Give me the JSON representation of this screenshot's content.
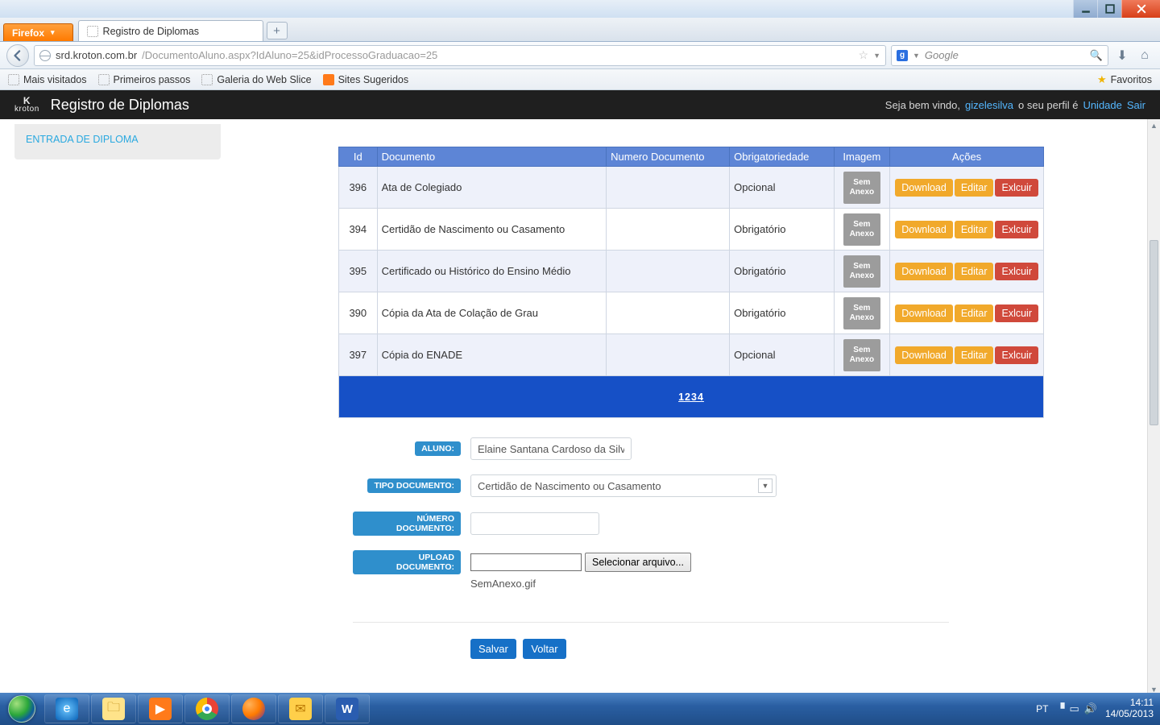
{
  "window": {
    "faded_title": ""
  },
  "browser": {
    "firefox_button": "Firefox",
    "tab_title": "Registro de Diplomas",
    "url_host": "srd.kroton.com.br",
    "url_path": "/DocumentoAluno.aspx?IdAluno=25&idProcessoGraduacao=25",
    "search_placeholder": "Google"
  },
  "bookmarks": {
    "b1": "Mais visitados",
    "b2": "Primeiros passos",
    "b3": "Galeria do Web Slice",
    "b4": "Sites Sugeridos",
    "fav": "Favoritos"
  },
  "appbar": {
    "brand": "kroton",
    "title": "Registro de Diplomas",
    "welcome_pre": "Seja bem vindo,",
    "user": "gizelesilva",
    "profile_txt": "o seu perfil é",
    "unit": "Unidade",
    "exit": "Sair"
  },
  "sidebar": {
    "entry": "ENTRADA DE DIPLOMA"
  },
  "table": {
    "headers": {
      "id": "Id",
      "doc": "Documento",
      "num": "Numero Documento",
      "ob": "Obrigatoriedade",
      "img": "Imagem",
      "ac": "Ações"
    },
    "noimg_l1": "Sem",
    "noimg_l2": "Anexo",
    "btn_dl": "Download",
    "btn_ed": "Editar",
    "btn_ex": "Exlcuir",
    "pager": "1234",
    "rows": [
      {
        "id": "396",
        "doc": "Ata de Colegiado",
        "num": "",
        "ob": "Opcional"
      },
      {
        "id": "394",
        "doc": "Certidão de Nascimento ou Casamento",
        "num": "",
        "ob": "Obrigatório"
      },
      {
        "id": "395",
        "doc": "Certificado ou Histórico do Ensino Médio",
        "num": "",
        "ob": "Obrigatório"
      },
      {
        "id": "390",
        "doc": "Cópia da Ata de Colação de Grau",
        "num": "",
        "ob": "Obrigatório"
      },
      {
        "id": "397",
        "doc": "Cópia do ENADE",
        "num": "",
        "ob": "Opcional"
      }
    ]
  },
  "form": {
    "l_aluno": "ALUNO:",
    "v_aluno": "Elaine Santana Cardoso da Silva",
    "l_tipo": "TIPO DOCUMENTO:",
    "v_tipo": "Certidão de Nascimento ou Casamento",
    "l_num": "NÚMERO DOCUMENTO:",
    "l_upload": "UPLOAD DOCUMENTO:",
    "file_btn": "Selecionar arquivo...",
    "filename": "SemAnexo.gif",
    "save": "Salvar",
    "back": "Voltar"
  },
  "taskbar": {
    "lang": "PT",
    "time": "14:11",
    "date": "14/05/2013"
  }
}
